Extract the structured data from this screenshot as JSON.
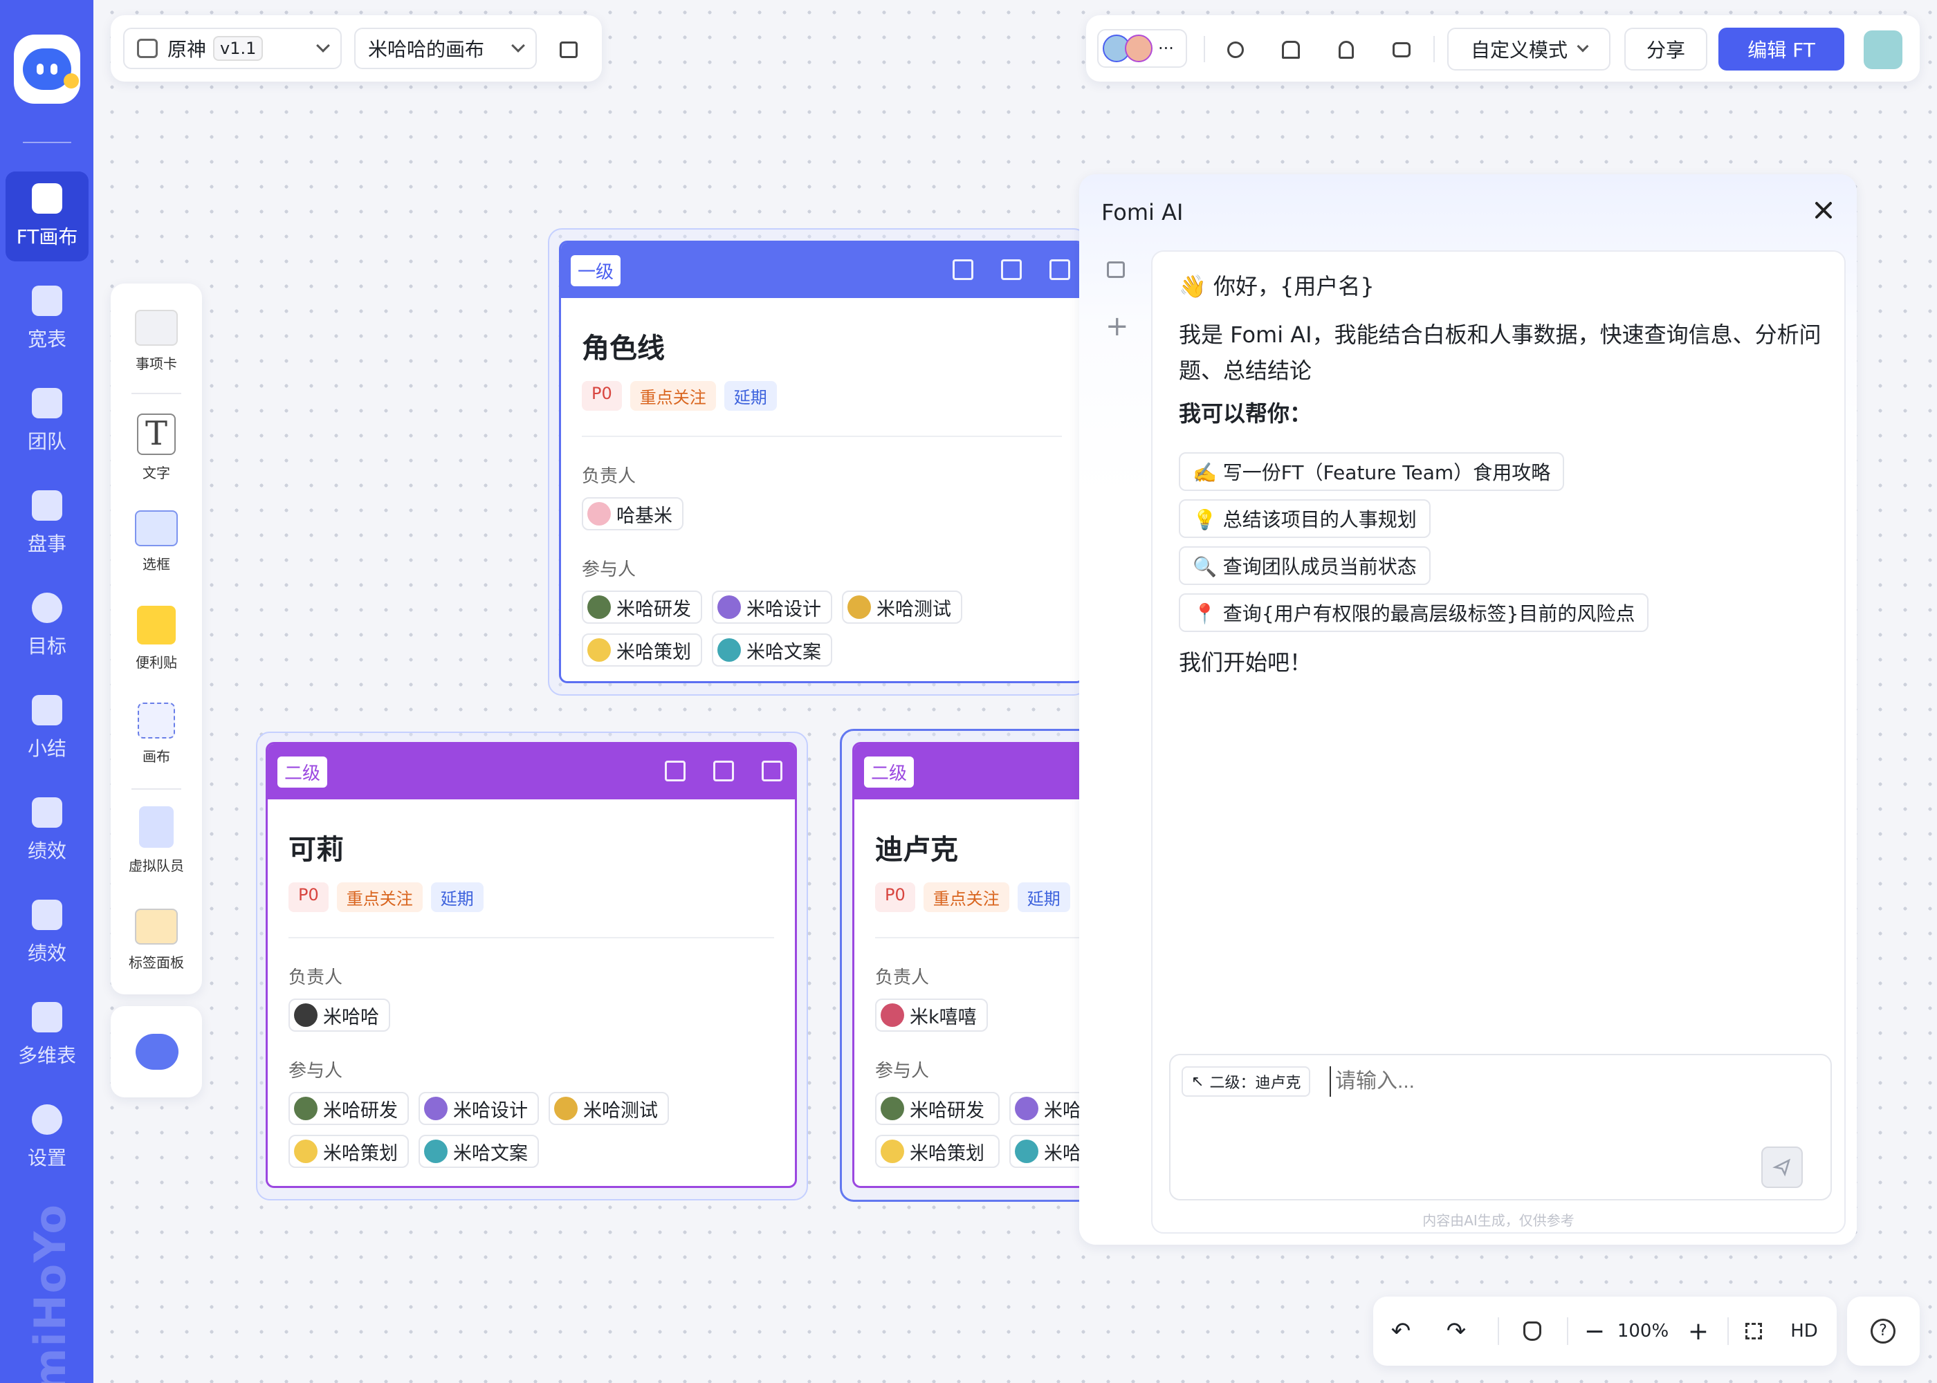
{
  "nav": {
    "items": [
      {
        "label": "FT画布",
        "icon": "canvas-icon"
      },
      {
        "label": "宽表",
        "icon": "table-icon"
      },
      {
        "label": "团队",
        "icon": "team-icon"
      },
      {
        "label": "盘事",
        "icon": "review-icon"
      },
      {
        "label": "目标",
        "icon": "target-icon"
      },
      {
        "label": "小结",
        "icon": "summary-icon"
      },
      {
        "label": "绩效",
        "icon": "performance-icon"
      },
      {
        "label": "绩效",
        "icon": "chart-icon"
      },
      {
        "label": "多维表",
        "icon": "multitable-icon"
      },
      {
        "label": "设置",
        "icon": "settings-icon"
      }
    ],
    "watermark": "miHoYo"
  },
  "toolbar": {
    "project": "原神",
    "version": "v1.1",
    "canvas": "米哈哈的画布",
    "more": "···",
    "mode": "自定义模式",
    "share": "分享",
    "edit": "编辑 FT"
  },
  "tools": [
    {
      "label": "事项卡"
    },
    {
      "label": "文字",
      "glyph": "T"
    },
    {
      "label": "选框"
    },
    {
      "label": "便利贴"
    },
    {
      "label": "画布"
    },
    {
      "label": "虚拟队员"
    },
    {
      "label": "标签面板"
    }
  ],
  "cards": {
    "top": {
      "level": "一级",
      "title": "角色线",
      "tags": [
        "P0",
        "重点关注",
        "延期"
      ],
      "owner_label": "负责人",
      "owner": "哈基米",
      "members_label": "参与人",
      "members": [
        "米哈研发",
        "米哈设计",
        "米哈测试",
        "米哈策划",
        "米哈文案"
      ]
    },
    "left": {
      "level": "二级",
      "title": "可莉",
      "tags": [
        "P0",
        "重点关注",
        "延期"
      ],
      "owner_label": "负责人",
      "owner": "米哈哈",
      "members_label": "参与人",
      "members": [
        "米哈研发",
        "米哈设计",
        "米哈测试",
        "米哈策划",
        "米哈文案"
      ]
    },
    "right": {
      "level": "二级",
      "title": "迪卢克",
      "tags": [
        "P0",
        "重点关注",
        "延期"
      ],
      "owner_label": "负责人",
      "owner": "米k嘻嘻",
      "members_label": "参与人",
      "members": [
        "米哈研发",
        "米哈",
        "米哈策划",
        "米哈"
      ]
    }
  },
  "ai": {
    "title": "Fomi AI",
    "greeting": "👋 你好，{用户名}",
    "intro": "我是 Fomi AI，我能结合白板和人事数据，快速查询信息、分析问题、总结结论",
    "help_title": "我可以帮你：",
    "suggestions": [
      "✍️ 写一份FT（Feature Team）食用攻略",
      "💡 总结该项目的人事规划",
      "🔍 查询团队成员当前状态",
      "📍 查询{用户有权限的最高层级标签}目前的风险点"
    ],
    "start": "我们开始吧！",
    "context": "二级：迪卢克",
    "placeholder": "请输入...",
    "disclaimer": "内容由AI生成，仅供参考"
  },
  "zoom": {
    "level": "100%",
    "hd": "HD",
    "help": "?"
  }
}
